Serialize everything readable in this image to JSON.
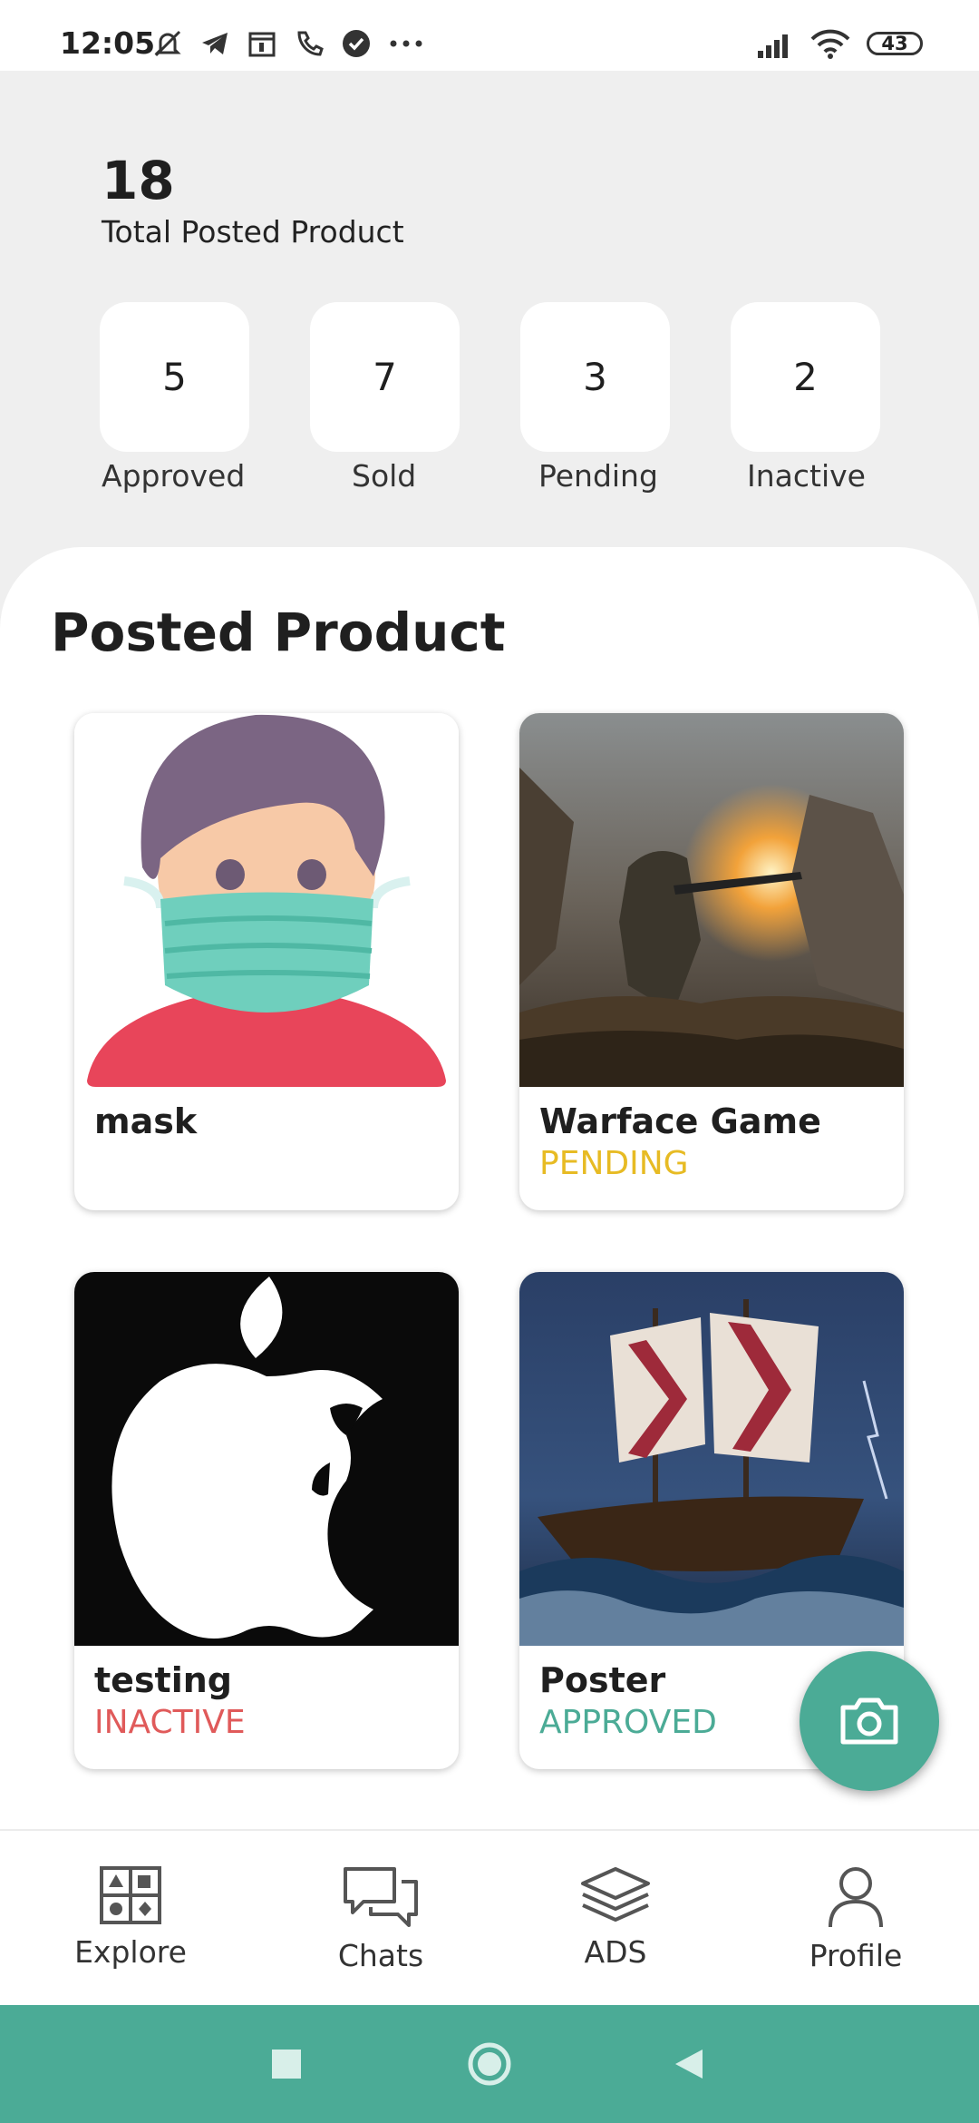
{
  "status_bar": {
    "time": "12:05",
    "battery": "43"
  },
  "summary": {
    "total_count": "18",
    "total_label": "Total Posted Product"
  },
  "stats": [
    {
      "value": "5",
      "label": "Approved"
    },
    {
      "value": "7",
      "label": "Sold"
    },
    {
      "value": "3",
      "label": "Pending"
    },
    {
      "value": "2",
      "label": "Inactive"
    }
  ],
  "section": {
    "title": "Posted Product"
  },
  "products": [
    {
      "name": "mask",
      "status": "",
      "image": "masked-person-illustration"
    },
    {
      "name": "Warface Game",
      "status": "PENDING",
      "image": "warface-battle-artwork"
    },
    {
      "name": "testing",
      "status": "INACTIVE",
      "image": "apple-logo-silhouette"
    },
    {
      "name": "Poster",
      "status": "APPROVED",
      "image": "pirate-ship-poster"
    }
  ],
  "fab": {
    "icon": "camera-icon"
  },
  "bottom_nav": [
    {
      "label": "Explore",
      "icon": "explore-grid-icon"
    },
    {
      "label": "Chats",
      "icon": "chat-bubbles-icon"
    },
    {
      "label": "ADS",
      "icon": "layers-icon"
    },
    {
      "label": "Profile",
      "icon": "person-icon"
    }
  ],
  "colors": {
    "accent": "#4bab96",
    "pending": "#e7bb24",
    "inactive": "#e05a5a",
    "approved": "#4bab96"
  }
}
